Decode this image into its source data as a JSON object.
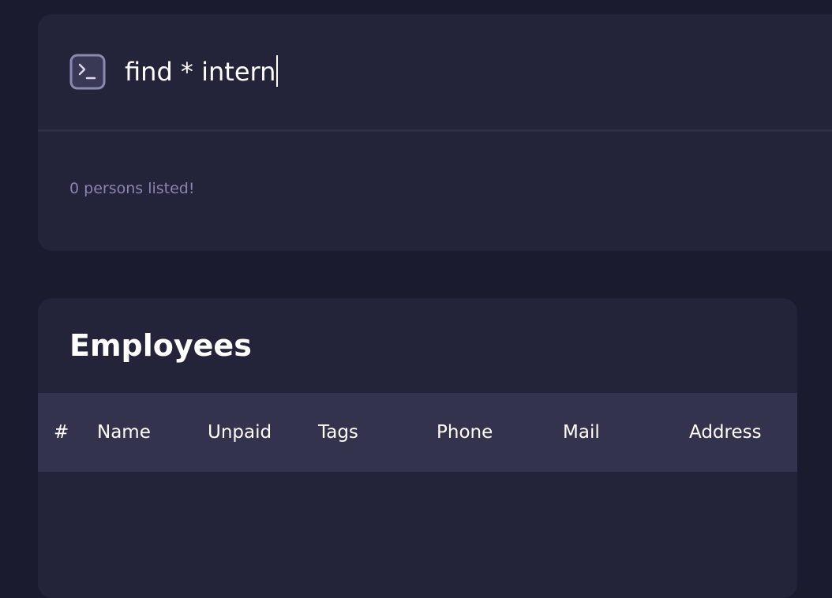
{
  "command": {
    "value": "find * intern",
    "icon": "terminal-icon"
  },
  "result": {
    "message": "0 persons listed!"
  },
  "employees": {
    "title": "Employees",
    "columns": [
      "#",
      "Name",
      "Unpaid",
      "Tags",
      "Phone",
      "Mail",
      "Address"
    ],
    "rows": []
  },
  "colors": {
    "background": "#1b1b2f",
    "panel": "#23233a",
    "table_header": "#34334d",
    "muted_text": "#8a86b0",
    "icon": "#8b8aae"
  }
}
